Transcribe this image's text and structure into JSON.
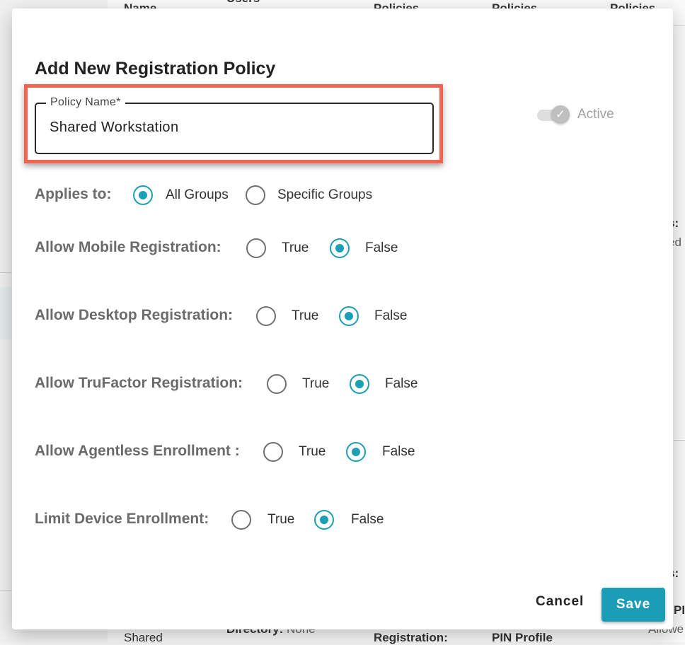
{
  "background": {
    "header_name": "Name",
    "header_users": "Users",
    "header_policies_1": "Policies",
    "header_policies_2": "Policies",
    "header_policies_3": "Policies",
    "right_fragment_1": "s:",
    "right_fragment_2": "ed",
    "right_fragment_3": "s:",
    "right_fragment_4": "PIN",
    "right_fragment_5": "Allowe",
    "row_name": "Shared",
    "directory_label": "Directory:",
    "directory_value": " None",
    "registration_label": "Registration:",
    "pin_profile": "PIN Profile"
  },
  "dialog": {
    "title": "Add New Registration Policy",
    "policy_name": {
      "label": "Policy Name*",
      "value": "Shared Workstation"
    },
    "active_toggle": {
      "label": "Active",
      "checked": true,
      "check_glyph": "✓"
    },
    "applies_to": {
      "label": "Applies to:",
      "options": [
        "All Groups",
        "Specific Groups"
      ],
      "selected": "All Groups"
    },
    "settings": [
      {
        "label": "Allow Mobile Registration:",
        "true_label": "True",
        "false_label": "False",
        "selected": "False"
      },
      {
        "label": "Allow Desktop Registration:",
        "true_label": "True",
        "false_label": "False",
        "selected": "False"
      },
      {
        "label": "Allow TruFactor Registration:",
        "true_label": "True",
        "false_label": "False",
        "selected": "False"
      },
      {
        "label": "Allow Agentless Enrollment :",
        "true_label": "True",
        "false_label": "False",
        "selected": "False"
      },
      {
        "label": "Limit Device Enrollment:",
        "true_label": "True",
        "false_label": "False",
        "selected": "False"
      }
    ],
    "buttons": {
      "cancel": "Cancel",
      "save": "Save"
    },
    "colors": {
      "accent": "#1c9db6",
      "highlight": "#f26352"
    }
  }
}
